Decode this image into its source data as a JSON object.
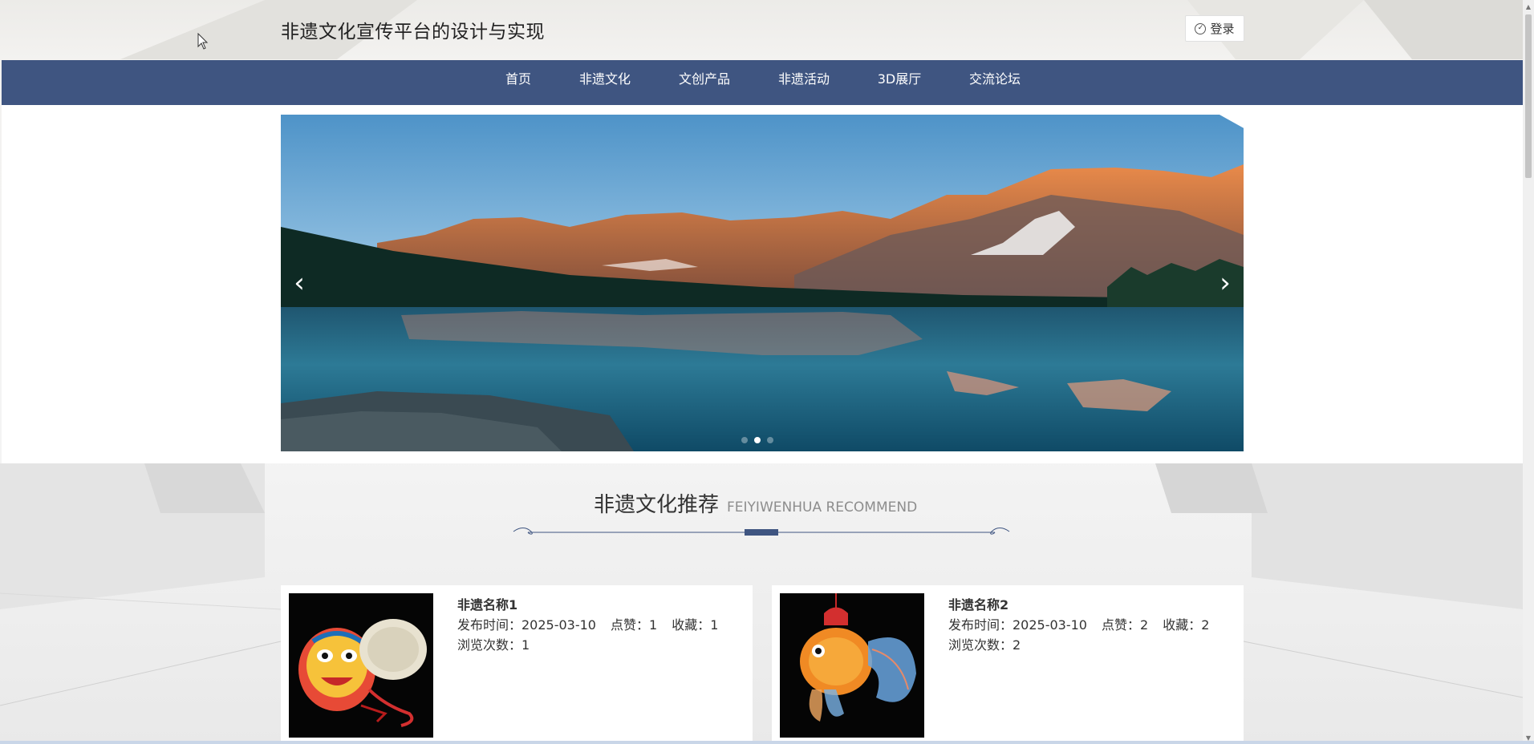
{
  "header": {
    "title": "非遗文化宣传平台的设计与实现",
    "login_label": "登录"
  },
  "nav": {
    "items": [
      "首页",
      "非遗文化",
      "文创产品",
      "非遗活动",
      "3D展厅",
      "交流论坛"
    ],
    "active_index": 0
  },
  "carousel": {
    "slide_count": 3,
    "active_dot": 1,
    "prev_icon": "chevron-left-icon",
    "next_icon": "chevron-right-icon"
  },
  "section": {
    "title_cn": "非遗文化推荐",
    "title_en": "FEIYIWENHUA RECOMMEND"
  },
  "cards": [
    {
      "name": "非遗名称1",
      "publish": "发布时间：2025-03-10",
      "likes": "点赞：1",
      "favorites": "收藏：1",
      "views": "浏览次数：1"
    },
    {
      "name": "非遗名称2",
      "publish": "发布时间：2025-03-10",
      "likes": "点赞：2",
      "favorites": "收藏：2",
      "views": "浏览次数：2"
    }
  ],
  "colors": {
    "nav_bg": "#3f5581",
    "nav_active_bg": "#e3cda7"
  }
}
